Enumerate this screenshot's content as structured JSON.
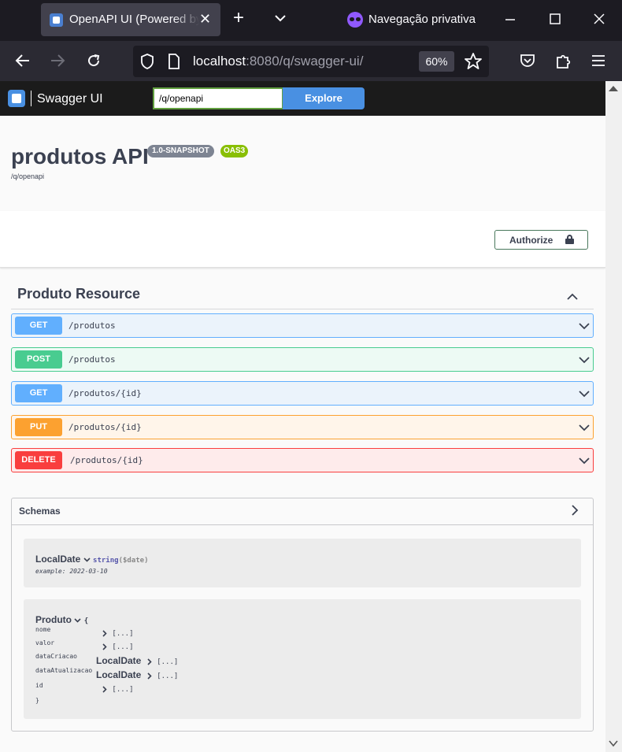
{
  "browser": {
    "tab_title": "OpenAPI UI (Powered by Quarkus)",
    "private_label": "Navegação privativa",
    "url_host": "localhost",
    "url_rest": ":8080/q/swagger-ui/",
    "zoom": "60%"
  },
  "swagger": {
    "brand": "Swagger UI",
    "spec_url": "/q/openapi",
    "explore_label": "Explore"
  },
  "info": {
    "title": "produtos API",
    "version": "1.0-SNAPSHOT",
    "oas": "OAS3",
    "spec_link": "/q/openapi"
  },
  "authorize_label": "Authorize",
  "tag": {
    "name": "Produto Resource",
    "operations": [
      {
        "method": "GET",
        "path": "/produtos"
      },
      {
        "method": "POST",
        "path": "/produtos"
      },
      {
        "method": "GET",
        "path": "/produtos/{id}"
      },
      {
        "method": "PUT",
        "path": "/produtos/{id}"
      },
      {
        "method": "DELETE",
        "path": "/produtos/{id}"
      }
    ]
  },
  "schemas": {
    "title": "Schemas",
    "local_date": {
      "name": "LocalDate",
      "type": "string",
      "format": "($date)",
      "example": "example: 2022-03-10"
    },
    "produto": {
      "name": "Produto",
      "open_brace": "{",
      "close_brace": "}",
      "collapsed": "[...]",
      "properties": [
        {
          "name": "nome"
        },
        {
          "name": "valor"
        },
        {
          "name": "dataCriacao",
          "ref": "LocalDate"
        },
        {
          "name": "dataAtualizacao",
          "ref": "LocalDate"
        },
        {
          "name": "id"
        }
      ]
    }
  },
  "colors": {
    "get": "#61affe",
    "post": "#49cc90",
    "put": "#fca130",
    "delete": "#f93e3e"
  }
}
